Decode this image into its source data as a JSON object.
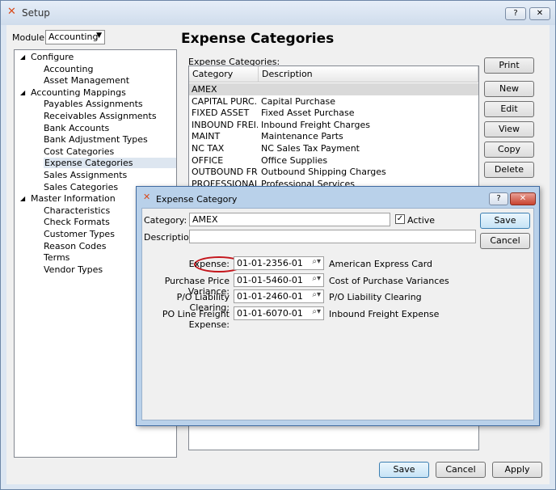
{
  "window": {
    "title": "Setup",
    "help": "?",
    "close": "✕"
  },
  "module": {
    "label": "Module:",
    "value": "Accounting"
  },
  "tree": [
    {
      "label": "Configure",
      "level": 0,
      "expanded": true
    },
    {
      "label": "Accounting",
      "level": 1
    },
    {
      "label": "Asset Management",
      "level": 1
    },
    {
      "label": "Accounting Mappings",
      "level": 0,
      "expanded": true
    },
    {
      "label": "Payables Assignments",
      "level": 1
    },
    {
      "label": "Receivables Assignments",
      "level": 1
    },
    {
      "label": "Bank Accounts",
      "level": 1
    },
    {
      "label": "Bank Adjustment Types",
      "level": 1
    },
    {
      "label": "Cost Categories",
      "level": 1
    },
    {
      "label": "Expense Categories",
      "level": 1,
      "selected": true
    },
    {
      "label": "Sales Assignments",
      "level": 1
    },
    {
      "label": "Sales Categories",
      "level": 1
    },
    {
      "label": "Master Information",
      "level": 0,
      "expanded": true
    },
    {
      "label": "Characteristics",
      "level": 1
    },
    {
      "label": "Check Formats",
      "level": 1
    },
    {
      "label": "Customer Types",
      "level": 1
    },
    {
      "label": "Reason Codes",
      "level": 1
    },
    {
      "label": "Terms",
      "level": 1
    },
    {
      "label": "Vendor Types",
      "level": 1
    }
  ],
  "main": {
    "heading": "Expense Categories",
    "list_label": "Expense Categories:",
    "columns": [
      "Category",
      "Description"
    ],
    "rows": [
      {
        "category": "AMEX",
        "description": ""
      },
      {
        "category": "CAPITAL PURC...",
        "description": "Capital Purchase"
      },
      {
        "category": "FIXED ASSET",
        "description": "Fixed Asset Purchase"
      },
      {
        "category": "INBOUND FREI...",
        "description": "Inbound Freight Charges"
      },
      {
        "category": "MAINT",
        "description": "Maintenance Parts"
      },
      {
        "category": "NC TAX",
        "description": "NC Sales Tax Payment"
      },
      {
        "category": "OFFICE",
        "description": "Office Supplies"
      },
      {
        "category": "OUTBOUND FR...",
        "description": "Outbound Shipping Charges"
      },
      {
        "category": "PROFESSIONAL...",
        "description": "Professional Services"
      }
    ],
    "side_buttons": [
      "Print",
      "New",
      "Edit",
      "View",
      "Copy",
      "Delete"
    ],
    "bottom_buttons": [
      "Save",
      "Cancel",
      "Apply"
    ]
  },
  "dialog": {
    "title": "Expense Category",
    "help": "?",
    "close": "✕",
    "category_label": "Category:",
    "category_value": "AMEX",
    "active_label": "Active",
    "active_checked": true,
    "description_label": "Description:",
    "description_value": "",
    "save": "Save",
    "cancel": "Cancel",
    "accounts": [
      {
        "label": "Expense:",
        "value": "01-01-2356-01",
        "desc": "American Express Card"
      },
      {
        "label": "Purchase Price Variance:",
        "value": "01-01-5460-01",
        "desc": "Cost of Purchase Variances"
      },
      {
        "label": "P/O Liability Clearing:",
        "value": "01-01-2460-01",
        "desc": "P/O Liability Clearing"
      },
      {
        "label": "PO Line Freight Expense:",
        "value": "01-01-6070-01",
        "desc": "Inbound Freight Expense"
      }
    ]
  },
  "colors": {
    "accent": "#c4161c",
    "dialog_frame": "#b9d1ea",
    "selection": "#dde6f0"
  }
}
